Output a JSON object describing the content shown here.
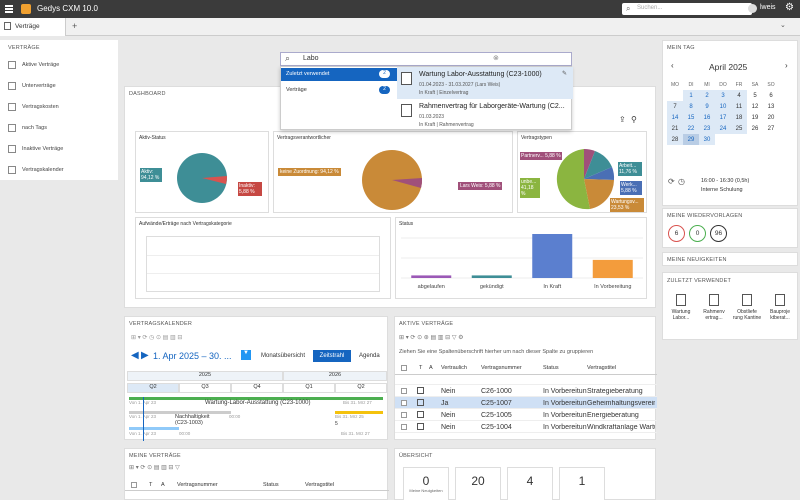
{
  "app": {
    "title": "Gedys CXM 10.0",
    "search_placeholder": "Suchen...",
    "user": "lweis"
  },
  "tabs": [
    {
      "label": "Verträge"
    },
    {
      "label": "+"
    }
  ],
  "sidebar": {
    "title": "VERTRÄGE",
    "items": [
      {
        "label": "Aktive Verträge"
      },
      {
        "label": "Unterverträge"
      },
      {
        "label": "Vertragskosten"
      },
      {
        "label": "nach Tags"
      },
      {
        "label": "Inaktive Verträge"
      },
      {
        "label": "Vertragskalender"
      }
    ]
  },
  "search": {
    "value": "Labo",
    "recent_label": "Zuletzt verwendet",
    "recent_count": "2",
    "contracts_label": "Verträge",
    "contracts_count": "2",
    "results": [
      {
        "title": "Wartung Labor-Ausstattung (C23-1000)",
        "dates": "01.04.2023 - 31.03.2027 (Lars Weis)",
        "status": "In Kraft | Einzelvertrag"
      },
      {
        "title": "Rahmenvertrag für Laborgeräte-Wartung (C2...",
        "dates": "01.03.2023",
        "status": "In Kraft | Rahmenvertrag"
      }
    ]
  },
  "dashboard": {
    "title": "DASHBOARD",
    "aktiv": {
      "title": "Aktiv-Status",
      "label_a": "Aktiv: 94,12 %",
      "label_b": "Inaktiv: 5,88 %"
    },
    "verantw": {
      "title": "Vertragsverantwortlicher",
      "label_a": "keine Zuordnung: 94,12 %",
      "label_b": "Lars Weis: 5,88 %"
    },
    "typen": {
      "title": "Vertragstypen",
      "labels": [
        "Partnerv... 5,88 %",
        "unbe... 41,18 %",
        "Arbeit... 11,76 %",
        "Werk... 5,88 %",
        "Wartungsv... 23,53 %"
      ]
    },
    "aufwand": {
      "title": "Aufwände/Erträge nach Vertragskategorie"
    },
    "status": {
      "title": "Status"
    }
  },
  "chart_data": [
    {
      "type": "pie",
      "title": "Aktiv-Status",
      "categories": [
        "Aktiv",
        "Inaktiv"
      ],
      "values": [
        94.12,
        5.88
      ]
    },
    {
      "type": "pie",
      "title": "Vertragsverantwortlicher",
      "categories": [
        "keine Zuordnung",
        "Lars Weis"
      ],
      "values": [
        94.12,
        5.88
      ]
    },
    {
      "type": "pie",
      "title": "Vertragstypen",
      "categories": [
        "Partnerv...",
        "unbe...",
        "Arbeit...",
        "Werk...",
        "Wartungsv..."
      ],
      "values": [
        5.88,
        41.18,
        11.76,
        5.88,
        23.53
      ]
    },
    {
      "type": "bar",
      "title": "Status",
      "categories": [
        "abgelaufen",
        "gekündigt",
        "In Kraft",
        "In Vorbereitung"
      ],
      "values": [
        1,
        1,
        17,
        7
      ]
    }
  ],
  "mein_tag": {
    "title": "MEIN TAG",
    "month": "April 2025",
    "weekdays": [
      "MO",
      "DI",
      "MI",
      "DO",
      "FR",
      "SA",
      "SO"
    ],
    "weeks": [
      [
        "",
        "1",
        "2",
        "3",
        "4",
        "5",
        "6"
      ],
      [
        "7",
        "8",
        "9",
        "10",
        "11",
        "12",
        "13"
      ],
      [
        "14",
        "15",
        "16",
        "17",
        "18",
        "19",
        "20"
      ],
      [
        "21",
        "22",
        "23",
        "24",
        "25",
        "26",
        "27"
      ],
      [
        "28",
        "29",
        "30",
        "",
        "",
        "",
        ""
      ]
    ],
    "event_time": "16:00 - 16:30 (0,5h)",
    "event_title": "Interne Schulung"
  },
  "wiedervorlagen": {
    "title": "MEINE WIEDERVORLAGEN",
    "counts": [
      "6",
      "0",
      "96"
    ]
  },
  "neuigkeiten": {
    "title": "MEINE NEUIGKEITEN"
  },
  "zuletzt": {
    "title": "ZULETZT VERWENDET",
    "items": [
      "Wartung Labor...",
      "Rahmenv ertrag...",
      "Obstliefe rung Kantine",
      "Bauproje ktberat..."
    ]
  },
  "kalender": {
    "title": "VERTRAGSKALENDER",
    "range": "1. Apr 2025 – 30. ...",
    "view_month": "Monatsübersicht",
    "view_timeline": "Zeitstrahl",
    "view_agenda": "Agenda",
    "years": [
      "2025",
      "2026"
    ],
    "quarters": [
      "Q2",
      "Q3",
      "Q4",
      "Q1",
      "Q2"
    ],
    "bar1": "Wartung-Labor-Ausstattung (C23-1000)",
    "bar1_start": "Von 1. Apr 23",
    "bar1_end": "Bis 31. Mrz 27",
    "bar2": "Nachhaltigkeit (C23-1003)",
    "bar2_start": "Von 1. Apr 23",
    "bar2_end": "Bis 31. Mrz 25",
    "bar3_start": "Von 1. Apr 23",
    "bar3_end": "Bis 31. Mrz 27",
    "bar2_time": "00:00",
    "bar3_time": "00:00"
  },
  "aktive": {
    "title": "AKTIVE VERTRÄGE",
    "group_hint": "Ziehen Sie eine Spaltenüberschrift hierher um nach dieser Spalte zu gruppieren",
    "headers": [
      "T",
      "A",
      "Vertraulich",
      "Vertragsnummer",
      "Status",
      "Vertragstitel"
    ],
    "rows": [
      {
        "v": "Nein",
        "n": "C26-1000",
        "s": "In Vorbereitun",
        "t": "Strategieberatung"
      },
      {
        "v": "Ja",
        "n": "C25-1007",
        "s": "In Vorbereitun",
        "t": "Geheimhaltungsvereinbaru"
      },
      {
        "v": "Nein",
        "n": "C25-1005",
        "s": "In Vorbereitun",
        "t": "Energieberatung"
      },
      {
        "v": "Nein",
        "n": "C25-1004",
        "s": "In Vorbereitun",
        "t": "Windkraftanlage Wartung"
      }
    ]
  },
  "meine": {
    "title": "MEINE VERTRÄGE",
    "headers": [
      "T",
      "A",
      "Vertragsnummer",
      "Status",
      "Vertragstitel"
    ]
  },
  "uebersicht": {
    "title": "ÜBERSICHT",
    "tiles": [
      "0",
      "20",
      "4",
      "1"
    ],
    "tile0_label": "Meine Neuigkeiten"
  },
  "colors": {
    "teal": "#3e8e96",
    "red": "#d9534f",
    "orange": "#d68a3a",
    "purple": "#a0507a",
    "green": "#8bb540",
    "bar_purple": "#9b59b6",
    "bar_blue": "#5b7fcf",
    "bar_orange": "#f39c3c",
    "selected": "#1565c0"
  }
}
